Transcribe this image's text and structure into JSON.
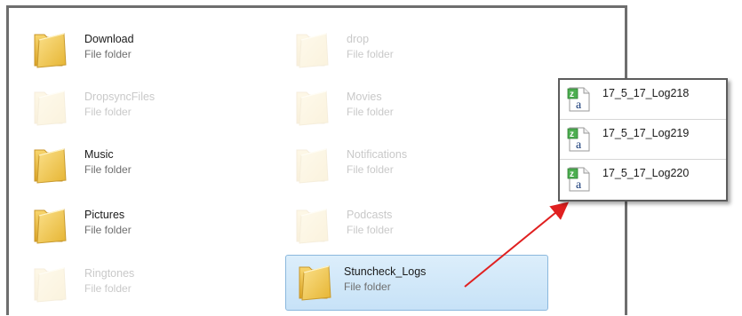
{
  "explorer": {
    "folders": [
      {
        "name": "Download",
        "type": "File folder",
        "state": "normal"
      },
      {
        "name": "drop",
        "type": "File folder",
        "state": "faded"
      },
      {
        "name": "DropsyncFiles",
        "type": "File folder",
        "state": "faded"
      },
      {
        "name": "Movies",
        "type": "File folder",
        "state": "faded"
      },
      {
        "name": "Music",
        "type": "File folder",
        "state": "normal"
      },
      {
        "name": "Notifications",
        "type": "File folder",
        "state": "faded"
      },
      {
        "name": "Pictures",
        "type": "File folder",
        "state": "normal"
      },
      {
        "name": "Podcasts",
        "type": "File folder",
        "state": "faded"
      },
      {
        "name": "Ringtones",
        "type": "File folder",
        "state": "faded"
      },
      {
        "name": "Stuncheck_Logs",
        "type": "File folder",
        "state": "selected"
      }
    ]
  },
  "log_panel": {
    "files": [
      {
        "name": "17_5_17_Log218",
        "icon": "compressed-text-file-icon"
      },
      {
        "name": "17_5_17_Log219",
        "icon": "compressed-text-file-icon"
      },
      {
        "name": "17_5_17_Log220",
        "icon": "compressed-text-file-icon"
      }
    ]
  },
  "colors": {
    "folder": "#f2c94c",
    "selection": "#cfe6f8",
    "arrow": "#e02020",
    "file_icon_green": "#4caf50"
  }
}
